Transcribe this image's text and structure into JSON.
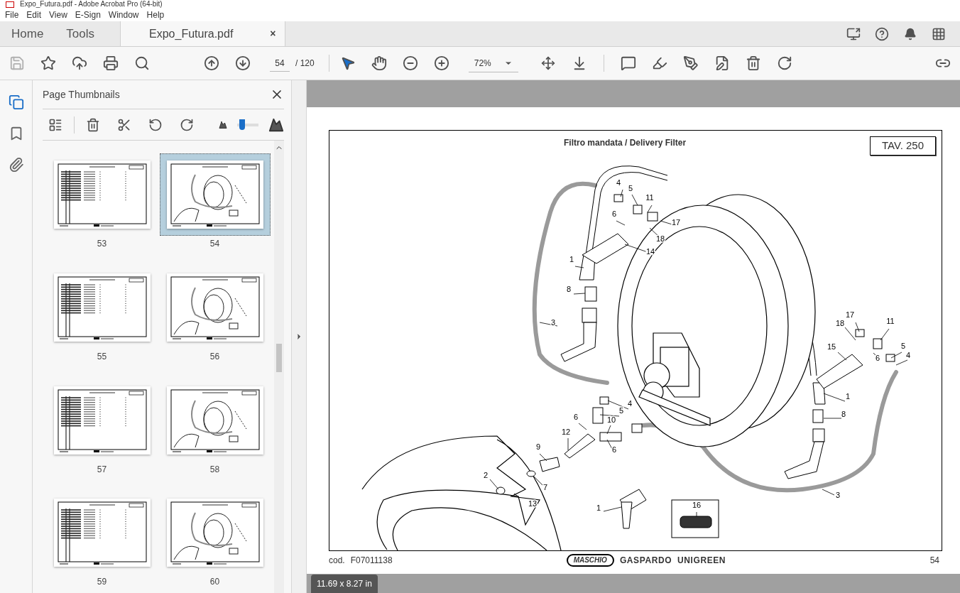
{
  "window": {
    "title": "Expo_Futura.pdf - Adobe Acrobat Pro (64-bit)"
  },
  "menu": [
    "File",
    "Edit",
    "View",
    "E-Sign",
    "Window",
    "Help"
  ],
  "tabs": [
    {
      "label": "Home",
      "selected": false
    },
    {
      "label": "Tools",
      "selected": false
    },
    {
      "label": "Expo_Futura.pdf",
      "selected": true,
      "close": "×"
    }
  ],
  "page_nav": {
    "current": "54",
    "total": "/ 120"
  },
  "zoom": {
    "value": "72%"
  },
  "nav_panels": [
    {
      "selected": true
    },
    {
      "selected": false
    },
    {
      "selected": false
    }
  ],
  "thumbnails_panel": {
    "title": "Page Thumbnails",
    "level": 0.2,
    "pages": [
      {
        "label": "53",
        "kind": "table",
        "selected": false
      },
      {
        "label": "54",
        "kind": "diagram",
        "selected": true
      },
      {
        "label": "55",
        "kind": "table",
        "selected": false
      },
      {
        "label": "56",
        "kind": "diagram",
        "selected": false
      },
      {
        "label": "57",
        "kind": "table",
        "selected": false
      },
      {
        "label": "58",
        "kind": "diagram",
        "selected": false
      },
      {
        "label": "59",
        "kind": "table",
        "selected": false
      },
      {
        "label": "60",
        "kind": "diagram",
        "selected": false
      }
    ]
  },
  "document": {
    "title": "Filtro mandata / Delivery Filter",
    "plate": "TAV. 250",
    "callouts": [
      "4",
      "5",
      "11",
      "6",
      "17",
      "18",
      "14",
      "1",
      "8",
      "3",
      "17",
      "18",
      "11",
      "15",
      "5",
      "4",
      "6",
      "1",
      "8",
      "4",
      "5",
      "6",
      "10",
      "12",
      "6",
      "9",
      "2",
      "7",
      "13",
      "3",
      "1",
      "16"
    ],
    "code_label": "cod.",
    "code": "F07011138",
    "brands": [
      "MASCHIO",
      "GASPARDO  UNIGREEN"
    ],
    "page_number": "54"
  },
  "page_size": "11.69 x 8.27 in"
}
